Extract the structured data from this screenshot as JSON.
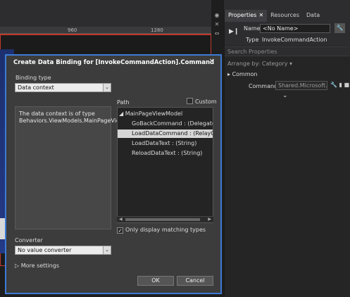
{
  "designer": {
    "ruler_marks": [
      "960",
      "1280"
    ]
  },
  "properties_panel": {
    "tabs": [
      {
        "label": "Properties",
        "active": true
      },
      {
        "label": "Resources",
        "active": false
      },
      {
        "label": "Data",
        "active": false
      }
    ],
    "name_label": "Name",
    "name_value": "<No Name>",
    "type_label": "Type",
    "type_value": "InvokeCommandAction",
    "search_placeholder": "Search Properties",
    "arrange_by": "Arrange by: Category ▾",
    "category": "Common",
    "command_label": "Command",
    "command_value": "Shared.Microsoft..."
  },
  "dialog": {
    "title": "Create Data Binding for [InvokeCommandAction].Command",
    "binding_type_label": "Binding type",
    "binding_type_value": "Data context",
    "description": "The data context is of type Behaviors.ViewModels.MainPageViewModel.",
    "path_label": "Path",
    "custom_label": "Custom",
    "tree": {
      "root": "MainPageViewModel",
      "items": [
        {
          "label": "GoBackCommand : (DelegateCom",
          "selected": false
        },
        {
          "label": "LoadDataCommand : (RelayComm",
          "selected": true
        },
        {
          "label": "LoadDataText : (String)",
          "selected": false
        },
        {
          "label": "ReloadDataText : (String)",
          "selected": false
        }
      ]
    },
    "only_matching_label": "Only display matching types",
    "only_matching_checked": true,
    "converter_label": "Converter",
    "converter_value": "No value converter",
    "more_settings": "More settings",
    "ok_label": "OK",
    "cancel_label": "Cancel"
  },
  "colors": {
    "accent_border": "#3d7bd6",
    "artboard_border": "#c0392b"
  }
}
